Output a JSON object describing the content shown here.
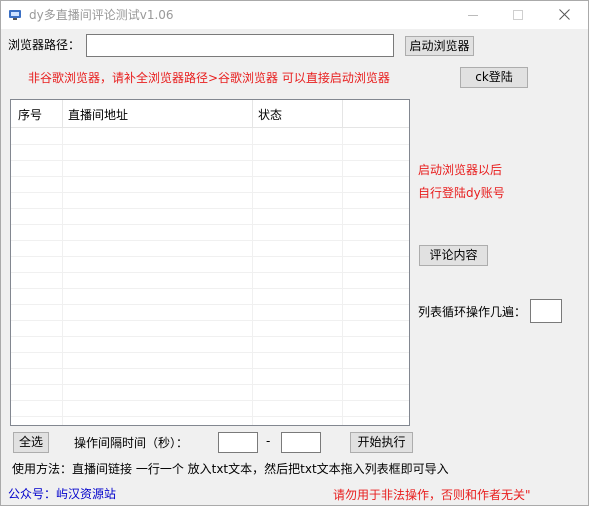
{
  "window": {
    "title": "dy多直播间评论测试v1.06"
  },
  "browser_path": {
    "label": "浏览器路径：",
    "value": "",
    "launch_button": "启动浏览器",
    "hint": "非谷歌浏览器，请补全浏览器路径>谷歌浏览器 可以直接启动浏览器",
    "login_button": "ck登陆"
  },
  "list": {
    "columns": [
      "序号",
      "直播间地址",
      "状态"
    ],
    "rows": []
  },
  "side": {
    "note_line1": "启动浏览器以后",
    "note_line2": "自行登陆dy账号",
    "comment_button": "评论内容",
    "loop_label": "列表循环操作几遍：",
    "loop_value": ""
  },
  "bottom": {
    "select_all": "全选",
    "interval_label": "操作间隔时间（秒）：",
    "interval_min": "",
    "dash": "-",
    "interval_max": "",
    "start_button": "开始执行",
    "usage": "使用方法：直播间链接 一行一个 放入txt文本，然后把txt文本拖入列表框即可导入",
    "wechat": "公众号：屿汉资源站",
    "warning": "请勿用于非法操作，否则和作者无关\""
  }
}
